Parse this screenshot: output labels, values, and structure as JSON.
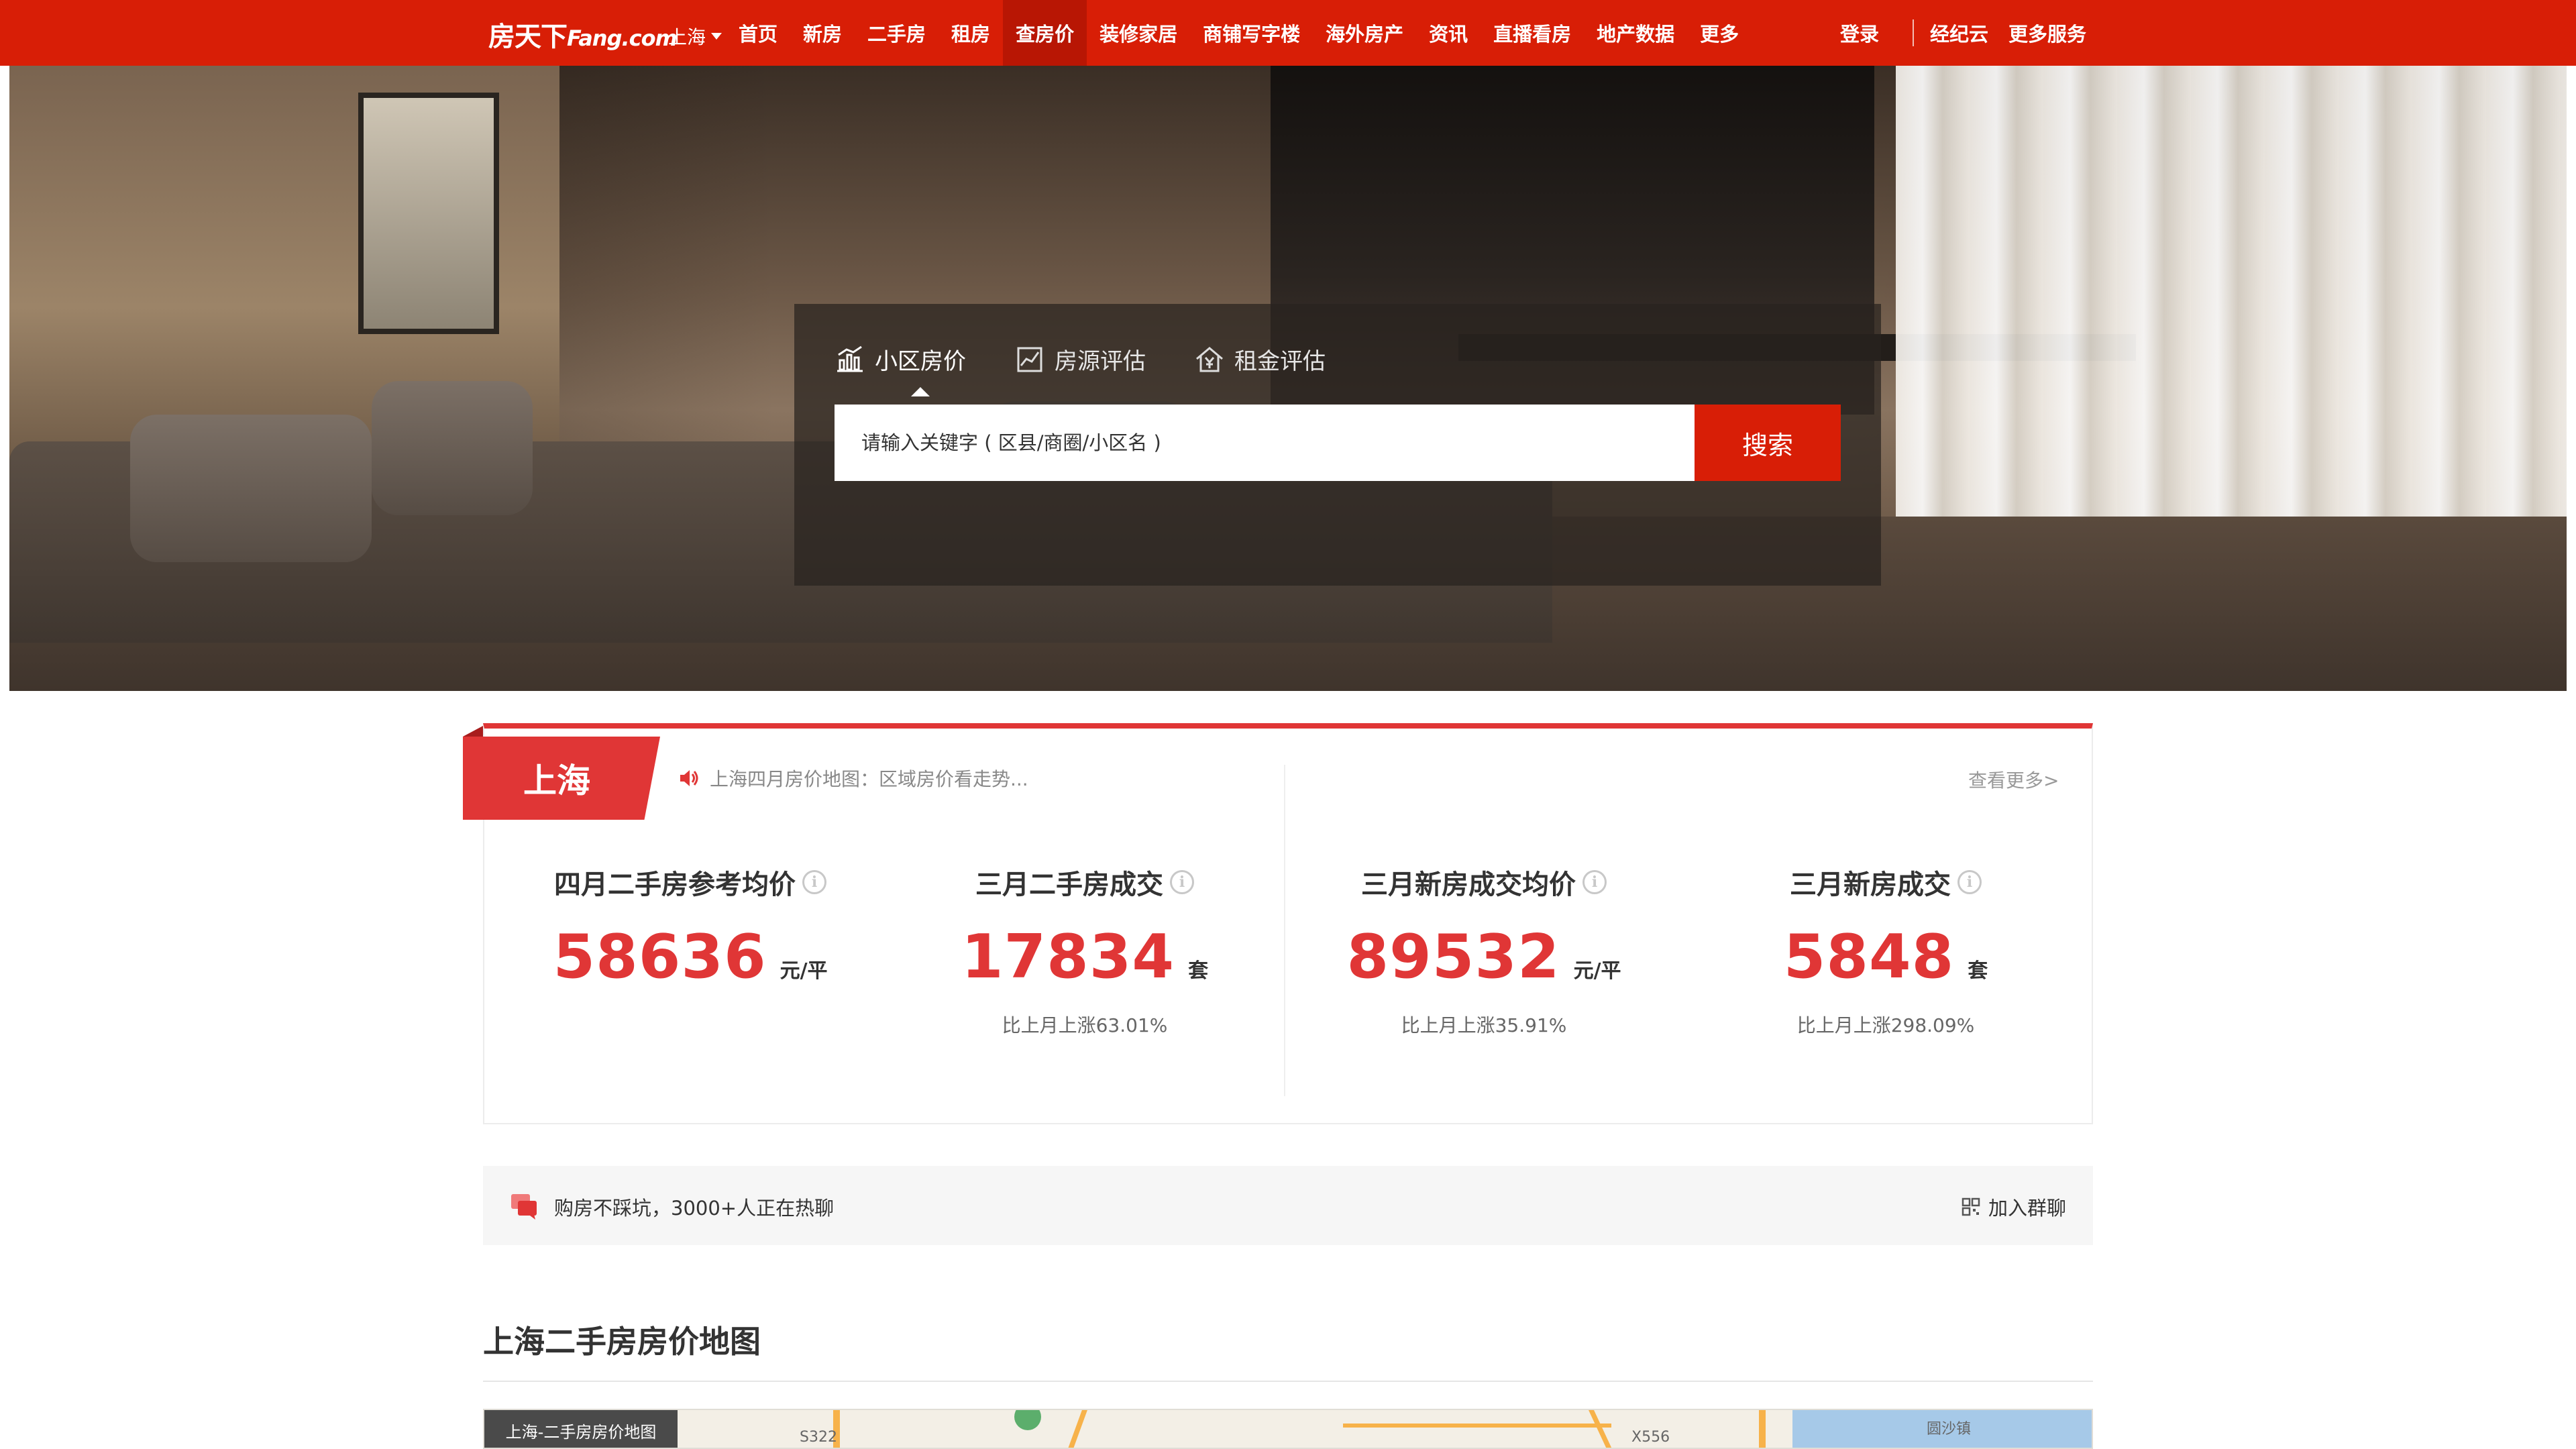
{
  "header": {
    "logo_cn": "房天下",
    "logo_en": "Fang.com",
    "city": "上海",
    "nav": [
      "首页",
      "新房",
      "二手房",
      "租房",
      "查房价",
      "装修家居",
      "商铺写字楼",
      "海外房产",
      "资讯",
      "直播看房",
      "地产数据",
      "更多"
    ],
    "active_nav": "查房价",
    "login": "登录",
    "right_links": [
      "经纪云",
      "更多服务"
    ]
  },
  "search": {
    "tabs": [
      {
        "label": "小区房价",
        "icon": "bar-chart-icon"
      },
      {
        "label": "房源评估",
        "icon": "trend-chart-icon"
      },
      {
        "label": "租金评估",
        "icon": "house-yen-icon"
      }
    ],
    "active_tab": "小区房价",
    "placeholder": "请输入关键字 ( 区县/商圈/小区名 )",
    "button": "搜索"
  },
  "stats": {
    "city": "上海",
    "ticker": "上海四月房价地图：区域房价看走势...",
    "see_more": "查看更多>",
    "items": [
      {
        "label": "四月二手房参考均价",
        "value": "58636",
        "unit": "元/平",
        "compare": ""
      },
      {
        "label": "三月二手房成交",
        "value": "17834",
        "unit": "套",
        "compare": "比上月上涨63.01%"
      },
      {
        "label": "三月新房成交均价",
        "value": "89532",
        "unit": "元/平",
        "compare": "比上月上涨35.91%"
      },
      {
        "label": "三月新房成交",
        "value": "5848",
        "unit": "套",
        "compare": "比上月上涨298.09%"
      }
    ]
  },
  "chat": {
    "text": "购房不踩坑，3000+人正在热聊",
    "join": "加入群聊"
  },
  "map_section": {
    "title": "上海二手房房价地图",
    "map_label": "上海-二手房房价地图",
    "places": [
      "S322",
      "X556",
      "圆沙镇"
    ]
  },
  "colors": {
    "brand_red": "#d81e06",
    "accent_red": "#e03636"
  }
}
